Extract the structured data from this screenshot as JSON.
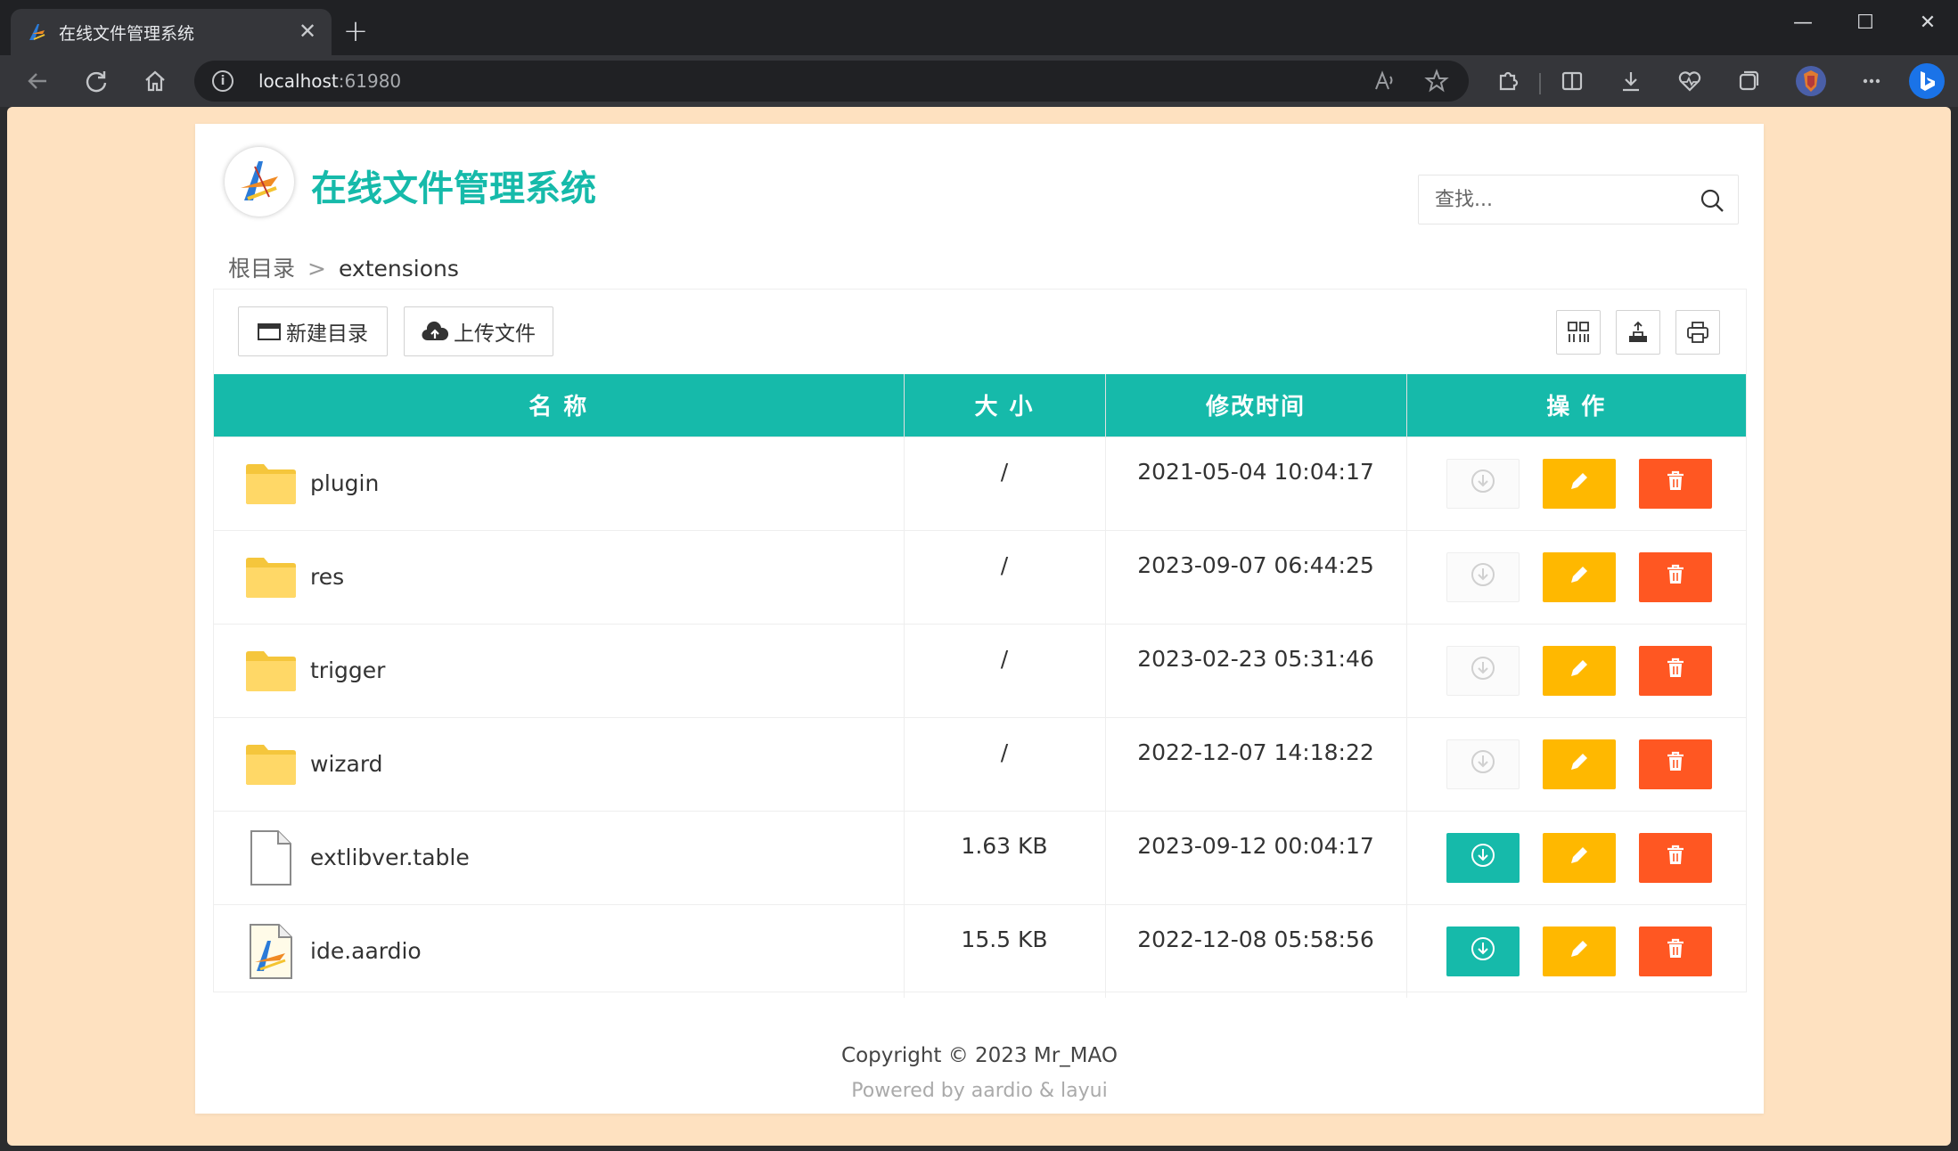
{
  "browser": {
    "tab_title": "在线文件管理系统",
    "tab_close": "✕",
    "new_tab": "+",
    "url_host": "localhost",
    "url_port": ":61980",
    "window": {
      "minimize": "—",
      "maximize": "☐",
      "close": "✕"
    }
  },
  "app": {
    "title": "在线文件管理系统",
    "search_placeholder": "查找...",
    "breadcrumb": {
      "root": "根目录",
      "separator": ">",
      "current": "extensions"
    },
    "actions": {
      "new_folder": "新建目录",
      "upload": "上传文件"
    },
    "table": {
      "headers": {
        "name": "名 称",
        "size": "大 小",
        "modified": "修改时间",
        "ops": "操 作"
      },
      "rows": [
        {
          "name": "plugin",
          "size": "/",
          "modified": "2021-05-04 10:04:17",
          "type": "folder",
          "downloadable": false
        },
        {
          "name": "res",
          "size": "/",
          "modified": "2023-09-07 06:44:25",
          "type": "folder",
          "downloadable": false
        },
        {
          "name": "trigger",
          "size": "/",
          "modified": "2023-02-23 05:31:46",
          "type": "folder",
          "downloadable": false
        },
        {
          "name": "wizard",
          "size": "/",
          "modified": "2022-12-07 14:18:22",
          "type": "folder",
          "downloadable": false
        },
        {
          "name": "extlibver.table",
          "size": "1.63 KB",
          "modified": "2023-09-12 00:04:17",
          "type": "file",
          "downloadable": true
        },
        {
          "name": "ide.aardio",
          "size": "15.5 KB",
          "modified": "2022-12-08 05:58:56",
          "type": "aardio",
          "downloadable": true
        }
      ]
    },
    "footer": {
      "copyright": "Copyright © 2023 Mr_MAO",
      "powered": "Powered by aardio & layui"
    }
  },
  "colors": {
    "accent": "#16baaa",
    "edit": "#ffb800",
    "delete": "#ff5722",
    "page_bg": "#fee1c0"
  }
}
